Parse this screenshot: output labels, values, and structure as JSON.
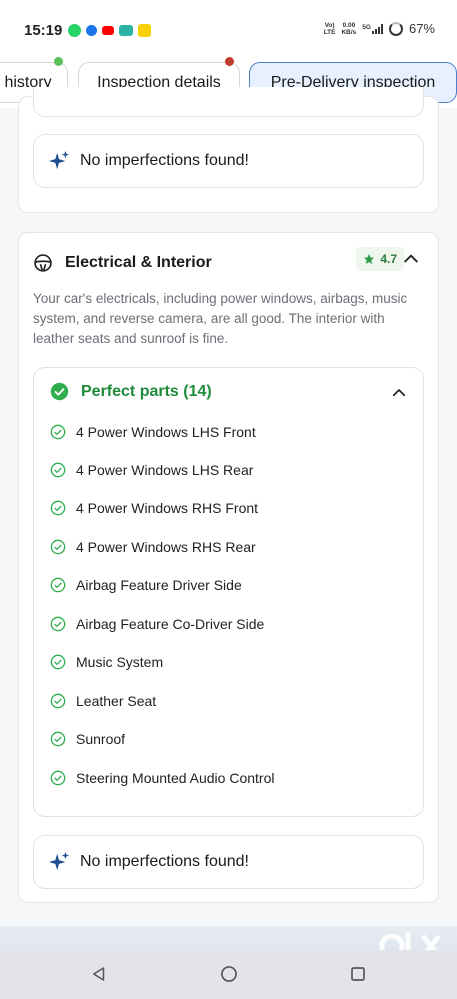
{
  "status_bar": {
    "time": "15:19",
    "network_top": "Vo)",
    "network_label": "LTE",
    "speed_value": "0.00",
    "speed_unit": "KB/s",
    "network_type": "5G",
    "battery": "67%",
    "app_icons": [
      "whatsapp-icon",
      "messages-icon",
      "youtube-icon",
      "app-icon",
      "flipkart-icon"
    ]
  },
  "tabs": {
    "items": [
      {
        "label": "history"
      },
      {
        "label": "Inspection details"
      },
      {
        "label": "Pre-Delivery inspection",
        "active": true
      }
    ],
    "dot_colors": [
      "#5bbf5a",
      "#c0392b"
    ],
    "active_bg": "#e6f0ff"
  },
  "top_card": {
    "no_imperfections": "No imperfections found!"
  },
  "electrical": {
    "title": "Electrical & Interior",
    "rating": "4.7",
    "description": "Your car's electricals, including power windows, airbags, music system, and reverse camera, are all good. The interior with leather seats and sunroof is fine.",
    "perfect_parts": {
      "label": "Perfect parts (14)",
      "items": [
        "4 Power Windows LHS Front",
        "4 Power Windows LHS Rear",
        "4 Power Windows RHS Front",
        "4 Power Windows RHS Rear",
        "Airbag Feature Driver Side",
        "Airbag Feature Co-Driver Side",
        "Music System",
        "Leather Seat",
        "Sunroof",
        "Steering Mounted Audio Control"
      ]
    },
    "no_imperfections": "No imperfections found!"
  },
  "colors": {
    "accent_green": "#1e8a3a",
    "sparkle_blue": "#1f4f8f",
    "active_border": "#4b7fc9"
  }
}
